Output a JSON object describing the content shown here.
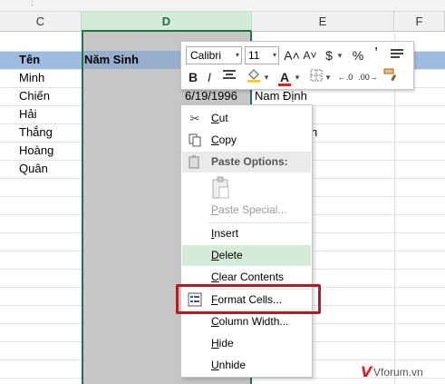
{
  "sheet": {
    "formula_grip": "∶",
    "columns": [
      "C",
      "D",
      "E",
      "F"
    ],
    "header_row": {
      "c": "Tên",
      "d": "Năm Sinh"
    },
    "names": [
      "Minh",
      "Chiến",
      "Hải",
      "Thắng",
      "Hoàng",
      "Quân"
    ],
    "e_row2_value": "6/19/1996",
    "e_row2_place": "Nam Định",
    "e_row4_fragment": "n",
    "accent_color": "#217346",
    "header_band_color": "#9ebce0"
  },
  "mini_toolbar": {
    "font_name": "Calibri",
    "font_size": "11",
    "grow_font": "A˄",
    "shrink_font": "A˅",
    "currency": "$",
    "percent": "%",
    "comma": "’",
    "bold": "B",
    "italic": "I",
    "font_color": "A",
    "inc_decimal": "←.0",
    "dec_decimal": ".00→"
  },
  "context_menu": {
    "items": [
      {
        "label": "Cut",
        "icon": "scissors-icon"
      },
      {
        "label": "Copy",
        "icon": "copy-icon"
      },
      {
        "label": "Paste Options:",
        "icon": "paste-icon"
      },
      {
        "label": "Paste Special...",
        "icon": ""
      },
      {
        "label": "Insert",
        "icon": ""
      },
      {
        "label": "Delete",
        "icon": ""
      },
      {
        "label": "Clear Contents",
        "icon": ""
      },
      {
        "label": "Format Cells...",
        "icon": "format-cells-icon"
      },
      {
        "label": "Column Width...",
        "icon": ""
      },
      {
        "label": "Hide",
        "icon": ""
      },
      {
        "label": "Unhide",
        "icon": ""
      }
    ],
    "highlight_color": "#d4ebd9",
    "callout_color": "#b01e22"
  },
  "watermark": {
    "mark": "V",
    "text": "Vforum.vn"
  }
}
